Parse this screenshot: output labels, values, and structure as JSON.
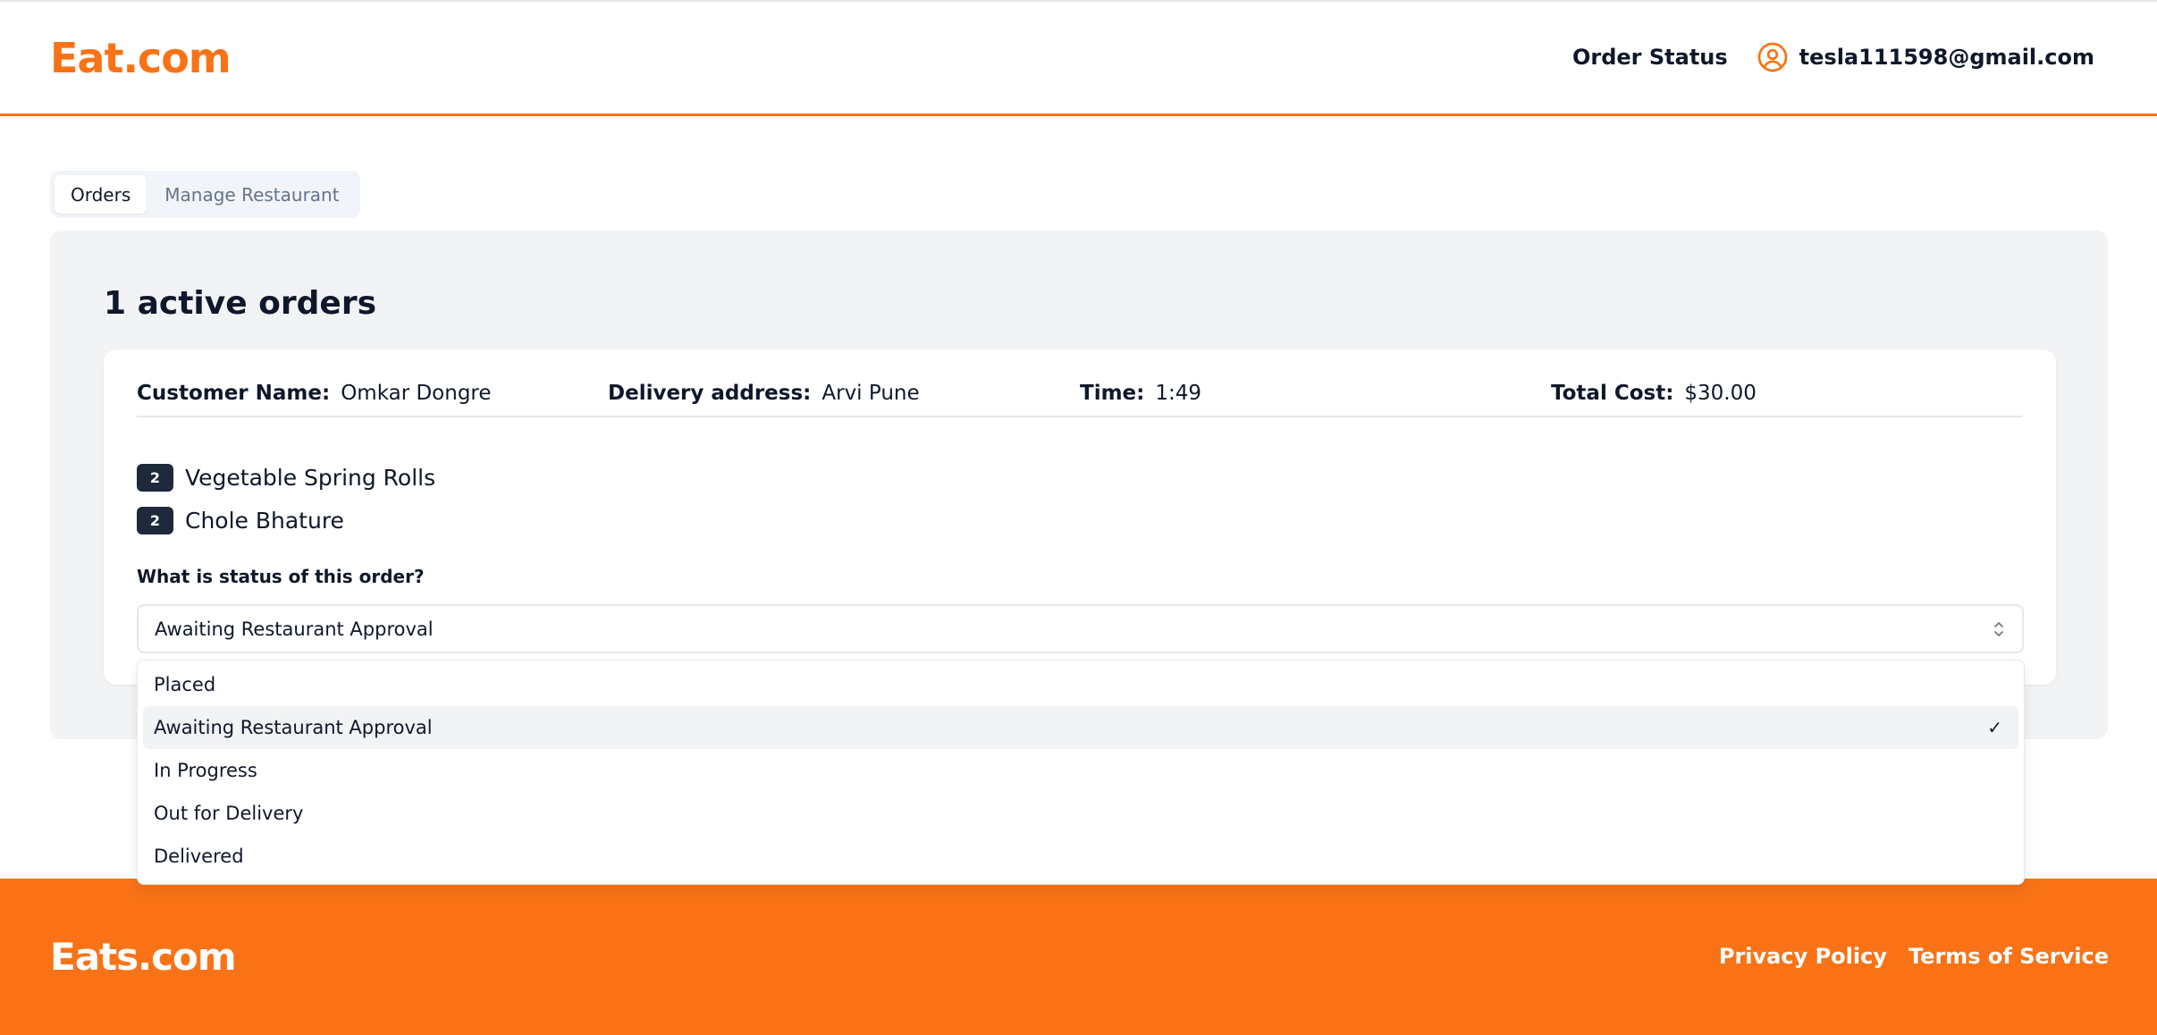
{
  "header": {
    "logo": "Eat.com",
    "nav_order_status": "Order Status",
    "user_email": "tesla111598@gmail.com",
    "accent_color": "#f97316"
  },
  "tabs": [
    {
      "label": "Orders",
      "active": true
    },
    {
      "label": "Manage Restaurant",
      "active": false
    }
  ],
  "orders": {
    "title": "1 active orders",
    "order": {
      "customer_name_label": "Customer Name:",
      "customer_name": "Omkar Dongre",
      "delivery_address_label": "Delivery address:",
      "delivery_address": "Arvi Pune",
      "time_label": "Time:",
      "time": "1:49",
      "total_cost_label": "Total Cost:",
      "total_cost": "$30.00",
      "items": [
        {
          "qty": "2",
          "name": "Vegetable Spring Rolls"
        },
        {
          "qty": "2",
          "name": "Chole Bhature"
        }
      ],
      "status_question": "What is status of this order?",
      "status_value": "Awaiting Restaurant Approval",
      "status_options": [
        "Placed",
        "Awaiting Restaurant Approval",
        "In Progress",
        "Out for Delivery",
        "Delivered"
      ]
    }
  },
  "footer": {
    "logo": "Eats.com",
    "privacy": "Privacy Policy",
    "terms": "Terms of Service"
  },
  "icons": {
    "user": "user-circle-icon",
    "chevron": "chevron-up-down-icon",
    "check": "check-icon"
  }
}
